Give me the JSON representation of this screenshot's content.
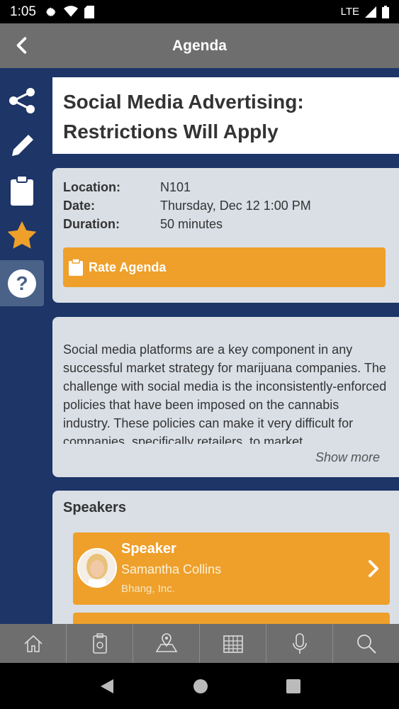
{
  "status_bar": {
    "time": "1:05",
    "network": "LTE"
  },
  "app_bar": {
    "title": "Agenda"
  },
  "session": {
    "title_line1": "Social Media Advertising:",
    "title_line2": "Restrictions Will Apply",
    "info": [
      {
        "label": "Location:",
        "value": "N101"
      },
      {
        "label": "Date:",
        "value": "Thursday, Dec 12 1:00 PM"
      },
      {
        "label": "Duration:",
        "value": "50 minutes"
      }
    ],
    "rate_label": "Rate Agenda",
    "description": "Social media platforms are a key component in any successful market strategy for marijuana companies. The challenge with social media is the inconsistently-enforced policies that have been imposed on the cannabis industry. These policies can make it very difficult for companies, specifically retailers, to market",
    "show_more": "Show more"
  },
  "speakers": {
    "heading": "Speakers",
    "items": [
      {
        "role": "Speaker",
        "name": "Samantha Collins",
        "company": "Bhang, Inc."
      }
    ]
  },
  "colors": {
    "accent": "#eea02b",
    "navy": "#1d3567",
    "card": "#dadfe6",
    "bar": "#6e6e6e"
  },
  "side_rail_icons": [
    "share-icon",
    "pencil-icon",
    "clipboard-icon",
    "star-icon",
    "help-icon"
  ],
  "tab_icons": [
    "home-icon",
    "badge-icon",
    "map-icon",
    "calendar-icon",
    "microphone-icon",
    "search-icon"
  ]
}
